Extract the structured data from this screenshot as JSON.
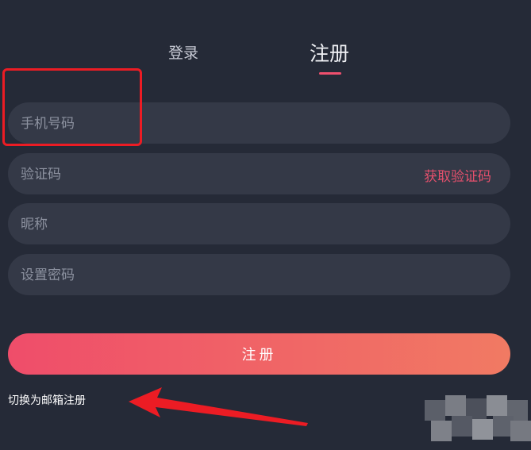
{
  "tabs": {
    "login": "登录",
    "register": "注册"
  },
  "form": {
    "phone_placeholder": "手机号码",
    "code_placeholder": "验证码",
    "get_code": "获取验证码",
    "nickname_placeholder": "昵称",
    "password_placeholder": "设置密码",
    "submit": "注册"
  },
  "switch_link": "切换为邮箱注册",
  "colors": {
    "background": "#252a37",
    "field": "#343947",
    "accent": "#f0506e",
    "highlight": "#ec1c24"
  }
}
